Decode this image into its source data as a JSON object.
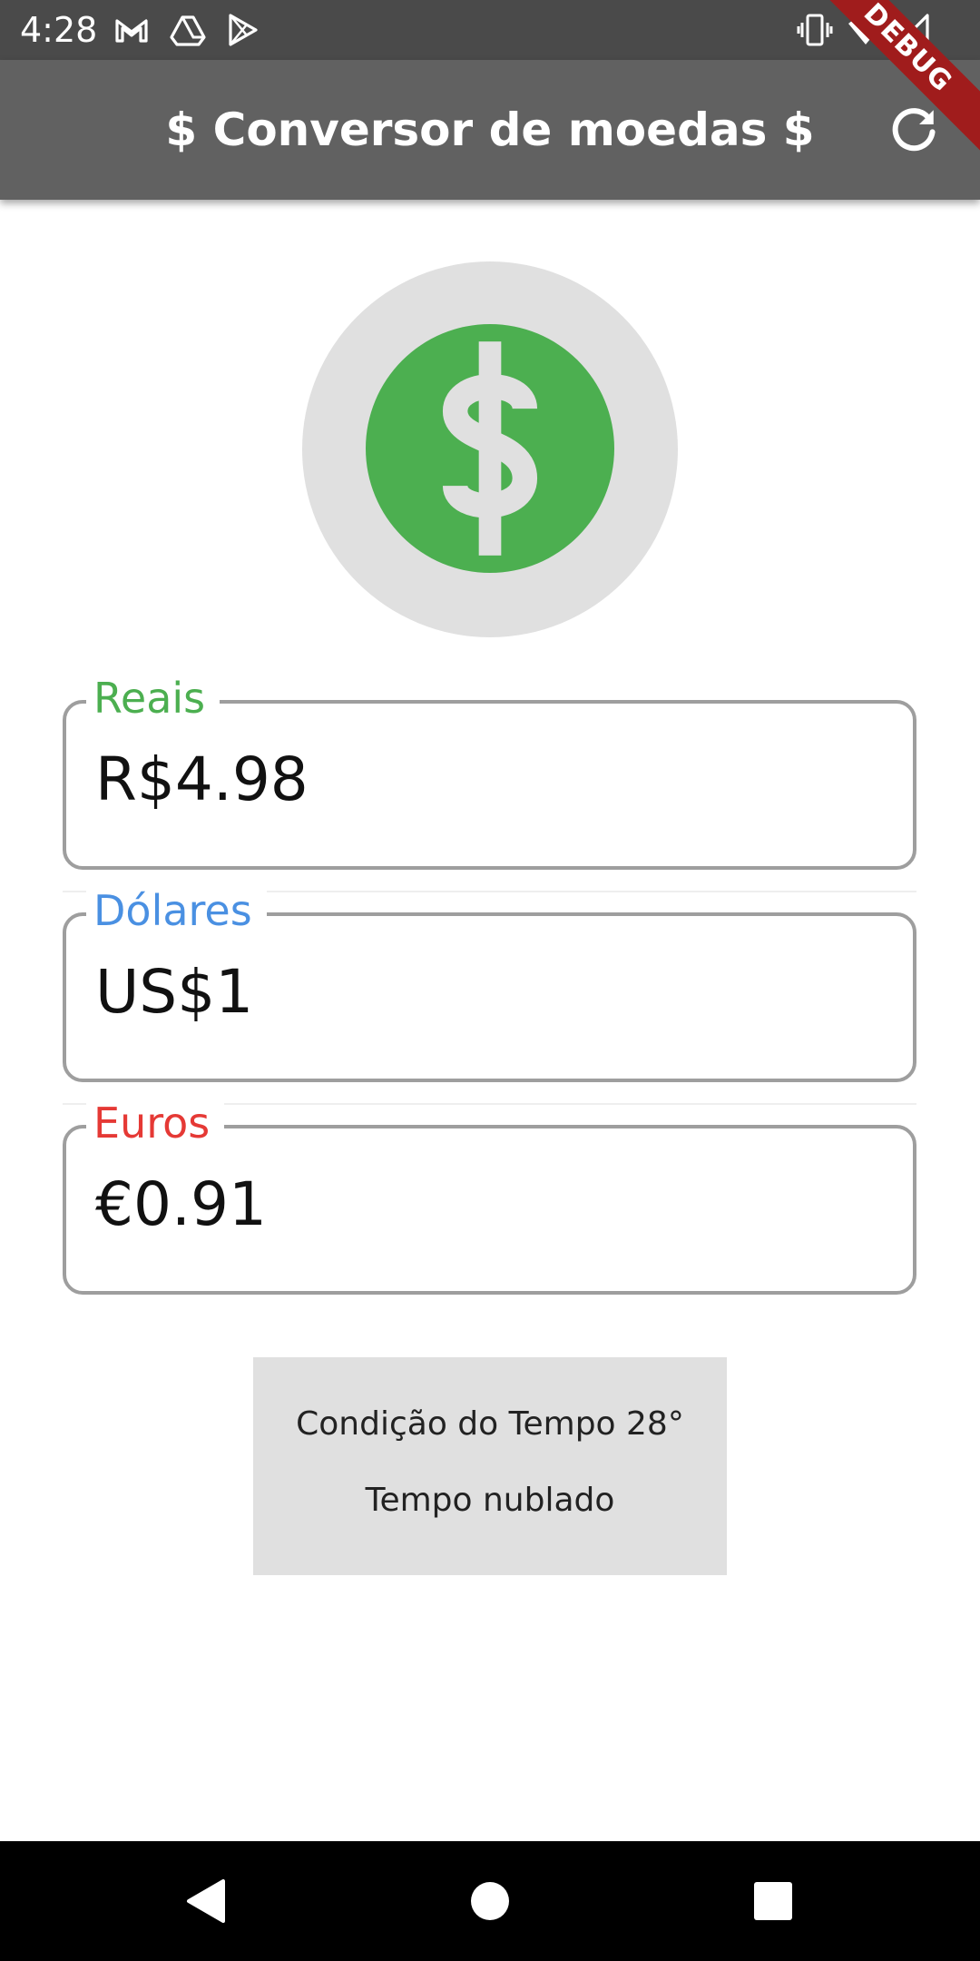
{
  "status_bar": {
    "time": "4:28",
    "icons": [
      "gmail-icon",
      "drive-icon",
      "play-store-icon",
      "vibrate-icon",
      "wifi-icon",
      "signal-icon"
    ]
  },
  "debug_banner": "DEBUG",
  "app_bar": {
    "title": "$ Conversor de moedas $",
    "action_icon": "refresh-icon"
  },
  "hero_icon": "monetization-on-icon",
  "fields": {
    "reais": {
      "label": "Reais",
      "value": "R$4.98",
      "color": "#4caf50"
    },
    "dolares": {
      "label": "Dólares",
      "value": "US$1",
      "color": "#4a90e2"
    },
    "euros": {
      "label": "Euros",
      "value": "€0.91",
      "color": "#e53935"
    }
  },
  "weather": {
    "condition": "Condição do Tempo 28°",
    "description": "Tempo nublado"
  },
  "nav_bar": {
    "icons": [
      "back-icon",
      "home-icon",
      "recents-icon"
    ]
  },
  "colors": {
    "app_bar": "#616161",
    "status_bar": "#4a4a4a",
    "accent_green": "#4caf50",
    "debug_red": "#a01c1c"
  }
}
